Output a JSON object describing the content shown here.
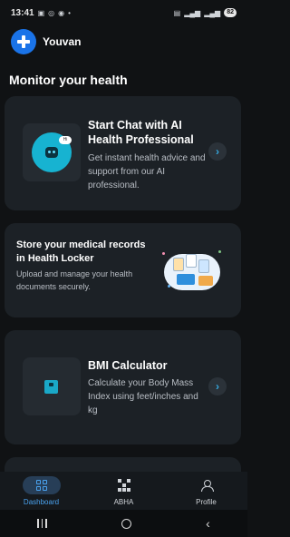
{
  "status_bar": {
    "time": "13:41",
    "left_icons": [
      "screenshot-icon",
      "chat-icon",
      "messenger-icon",
      "dot-icon"
    ],
    "right_icons": [
      "sim-icon",
      "signal-icon",
      "signal-icon-2"
    ],
    "battery": "82"
  },
  "header": {
    "app_name": "Youvan"
  },
  "main": {
    "section_title": "Monitor your health",
    "cards": [
      {
        "title": "Start Chat with AI Health Professional",
        "description": "Get instant health advice and support from our AI professional."
      },
      {
        "title": "Store your medical records in Health Locker",
        "description": "Upload and manage your health documents securely."
      },
      {
        "title": "BMI Calculator",
        "description": "Calculate your Body Mass Index using feet/inches and kg"
      }
    ],
    "chat_bubble_text": "Hi"
  },
  "bottom_nav": {
    "items": [
      {
        "label": "Dashboard",
        "icon": "dashboard-icon",
        "active": true
      },
      {
        "label": "ABHA",
        "icon": "qr-code-icon",
        "active": false
      },
      {
        "label": "Profile",
        "icon": "profile-icon",
        "active": false
      }
    ]
  },
  "colors": {
    "background": "#101214",
    "card": "#1c2126",
    "accent": "#1a73e8",
    "active_nav": "#4aa3f0"
  }
}
